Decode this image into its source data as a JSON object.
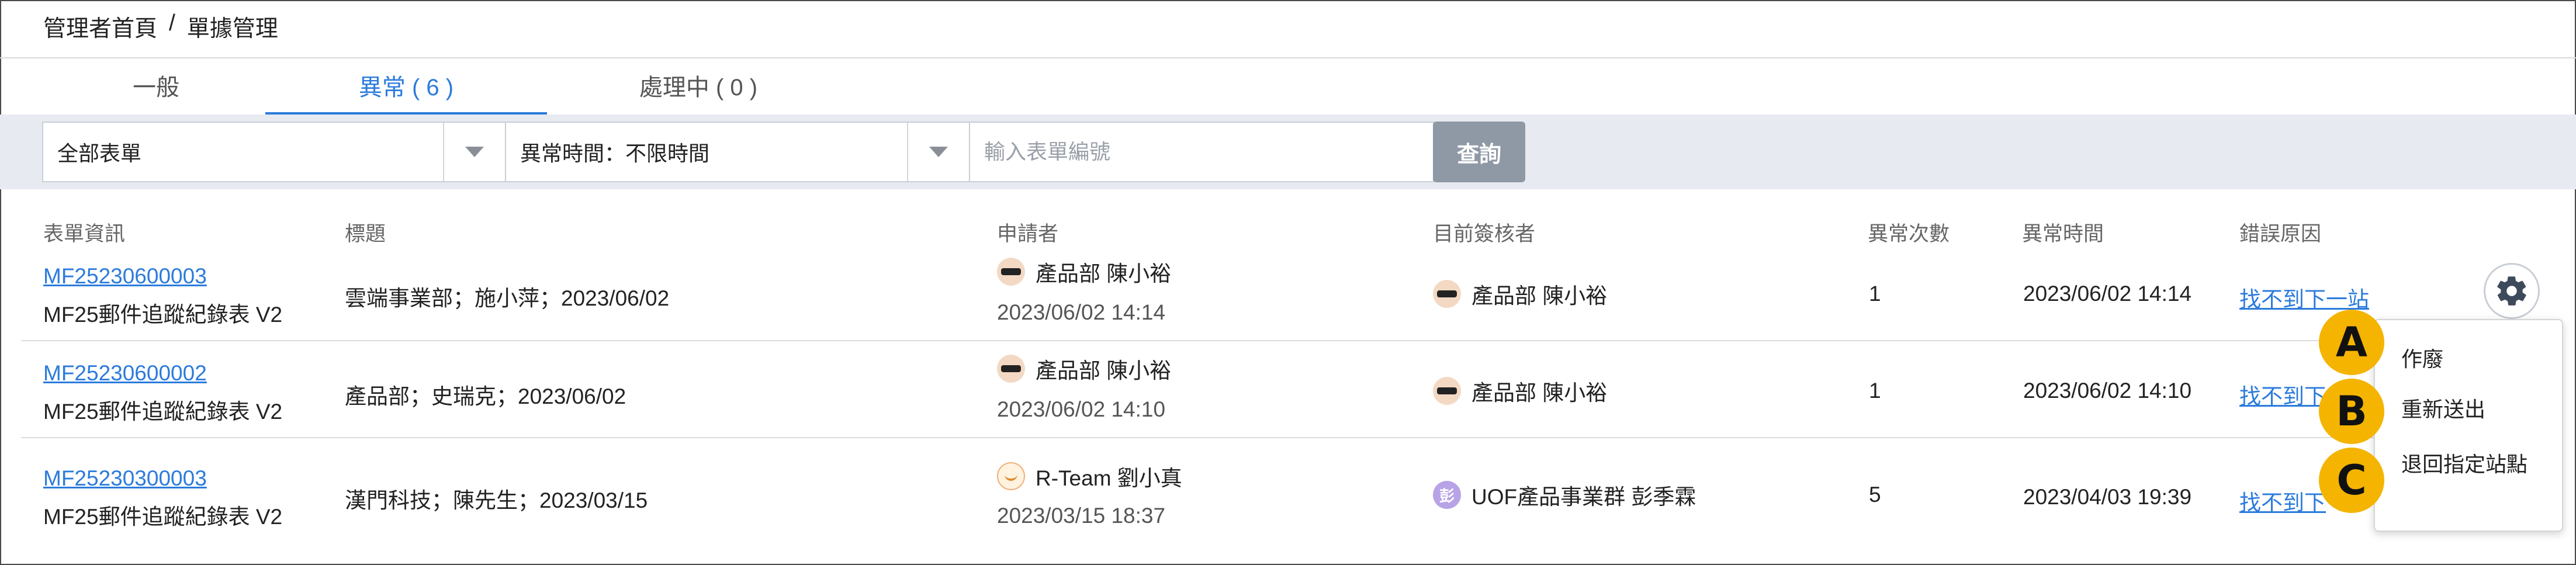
{
  "breadcrumb": {
    "home": "管理者首頁",
    "sep": "/",
    "current": "單據管理"
  },
  "tabs": [
    {
      "label": "一般"
    },
    {
      "label": "異常 ( 6 )"
    },
    {
      "label": "處理中 ( 0 )"
    }
  ],
  "filters": {
    "form_type": "全部表單",
    "exception_time": "異常時間：不限時間",
    "form_no_placeholder": "輸入表單編號",
    "query_label": "查詢"
  },
  "table": {
    "headers": [
      "表單資訊",
      "標題",
      "申請者",
      "目前簽核者",
      "異常次數",
      "異常時間",
      "錯誤原因"
    ],
    "rows": [
      {
        "form_id": "MF25230600003",
        "form_name": "MF25郵件追蹤紀錄表 V2",
        "title": "雲端事業部；施小萍；2023/06/02",
        "applicant": "產品部 陳小裕",
        "apply_time": "2023/06/02 14:14",
        "approver": "產品部 陳小裕",
        "count": "1",
        "exception_time": "2023/06/02 14:14",
        "reason": "找不到下一站"
      },
      {
        "form_id": "MF25230600002",
        "form_name": "MF25郵件追蹤紀錄表 V2",
        "title": "產品部；史瑞克；2023/06/02",
        "applicant": "產品部 陳小裕",
        "apply_time": "2023/06/02 14:10",
        "approver": "產品部 陳小裕",
        "count": "1",
        "exception_time": "2023/06/02 14:10",
        "reason": "找不到下"
      },
      {
        "form_id": "MF25230300003",
        "form_name": "MF25郵件追蹤紀錄表 V2",
        "title": "漢門科技；陳先生；2023/03/15",
        "applicant": "R-Team 劉小真",
        "apply_time": "2023/03/15 18:37",
        "approver": "UOF產品事業群 彭季霖",
        "approver_avatar_letter": "彭",
        "count": "5",
        "exception_time": "2023/04/03 19:39",
        "reason": "找不到下"
      }
    ]
  },
  "action_menu": {
    "items": [
      "作廢",
      "重新送出",
      "退回指定站點"
    ],
    "badges": [
      "A",
      "B",
      "C"
    ]
  },
  "colors": {
    "accent": "#2b7bdc",
    "badge": "#f4b400",
    "filter_bg": "#e7ebf1",
    "query_button": "#8f99a6"
  }
}
